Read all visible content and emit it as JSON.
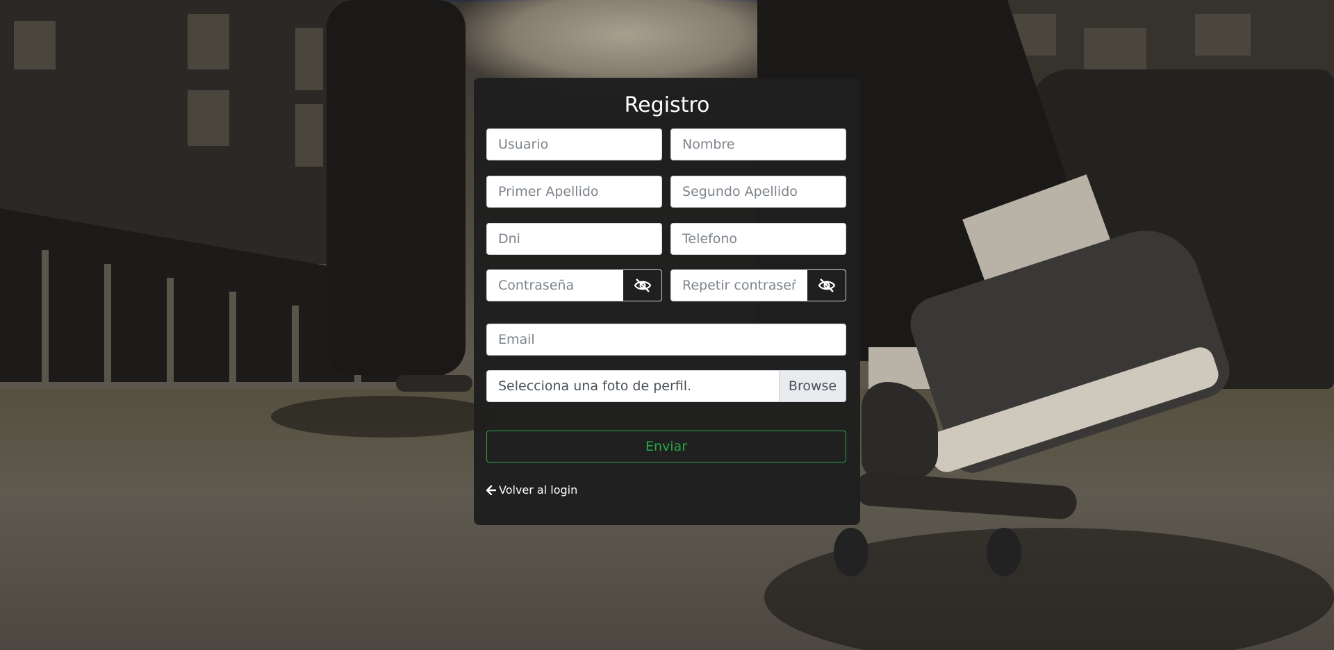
{
  "form": {
    "title": "Registro",
    "fields": {
      "usuario": "Usuario",
      "nombre": "Nombre",
      "primer_apellido": "Primer Apellido",
      "segundo_apellido": "Segundo Apellido",
      "dni": "Dni",
      "telefono": "Telefono",
      "contrasena": "Contraseña",
      "repetir_contrasena": "Repetir contraseña",
      "email": "Email"
    },
    "file_label": "Selecciona una foto de perfil.",
    "browse_label": "Browse",
    "submit_label": "Enviar",
    "back_link": "Volver al login",
    "icons": {
      "password_toggle": "eye-slash-icon",
      "back": "arrow-left-icon"
    },
    "colors": {
      "card_bg": "#1e1e1e",
      "accent": "#28a745"
    }
  }
}
